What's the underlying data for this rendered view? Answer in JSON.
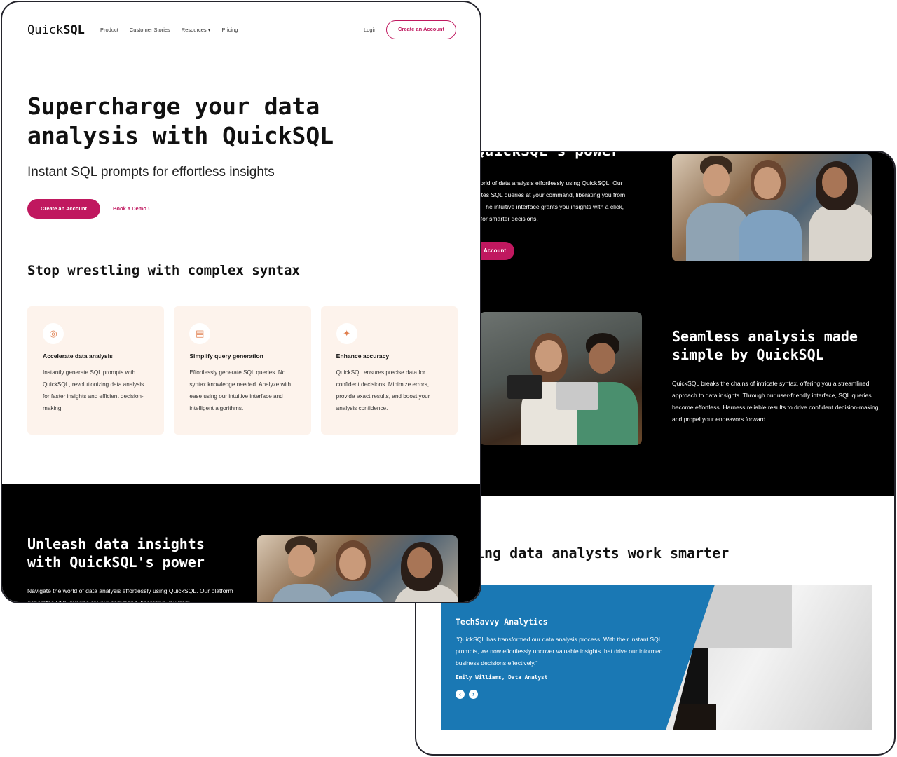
{
  "colors": {
    "accent": "#c0185f",
    "card_bg": "#fdf3ec",
    "testimonial_blue": "#1a78b4",
    "dark": "#000000"
  },
  "nav": {
    "logo_light": "Quick",
    "logo_bold": "SQL",
    "links": [
      "Product",
      "Customer Stories",
      "Resources ▾",
      "Pricing"
    ],
    "login": "Login",
    "cta": "Create an Account"
  },
  "hero": {
    "title": "Supercharge your data analysis with QuickSQL",
    "subtitle": "Instant SQL prompts for effortless insights",
    "cta": "Create an Account",
    "demo": "Book a Demo ›"
  },
  "features": {
    "title": "Stop wrestling with complex syntax",
    "cards": [
      {
        "icon": "eye-icon",
        "glyph": "◎",
        "title": "Accelerate data analysis",
        "text": "Instantly generate SQL prompts with QuickSQL, revolutionizing data analysis for faster insights and efficient decision-making."
      },
      {
        "icon": "window-icon",
        "glyph": "▤",
        "title": "Simplify query generation",
        "text": "Effortlessly generate SQL queries. No syntax knowledge needed. Analyze with ease using our intuitive interface and intelligent algorithms."
      },
      {
        "icon": "target-icon",
        "glyph": "✦",
        "title": "Enhance accuracy",
        "text": "QuickSQL ensures precise data for confident decisions. Minimize errors, provide exact results, and boost your analysis confidence."
      }
    ]
  },
  "insights": {
    "title": "Unleash data insights with QuickSQL's power",
    "paragraph": "Navigate the world of data analysis effortlessly using QuickSQL. Our platform generates SQL queries at your command, liberating you from",
    "cut_title": "QuickSQL's power",
    "cut_paragraph": [
      "world of data analysis effortlessly using QuickSQL. Our",
      "rates SQL queries at your command, liberating you from",
      "x. The intuitive interface grants you insights with a click,",
      "y for smarter decisions."
    ],
    "cut_cta": "Account"
  },
  "seamless": {
    "title": "Seamless analysis made simple by QuickSQL",
    "paragraph": "QuickSQL breaks the chains of intricate syntax, offering you a streamlined approach to data insights. Through our user-friendly interface, SQL queries become effortless. Harness reliable results to drive confident decision-making, and propel your endeavors forward."
  },
  "testimonials": {
    "title": "ing data analysts work smarter",
    "company": "TechSavvy Analytics",
    "quote": "\"QuickSQL has transformed our data analysis process. With their instant SQL prompts, we now effortlessly uncover valuable insights that drive our informed business decisions effectively.\"",
    "author": "Emily Williams, Data Analyst",
    "prev": "‹",
    "next": "›"
  }
}
